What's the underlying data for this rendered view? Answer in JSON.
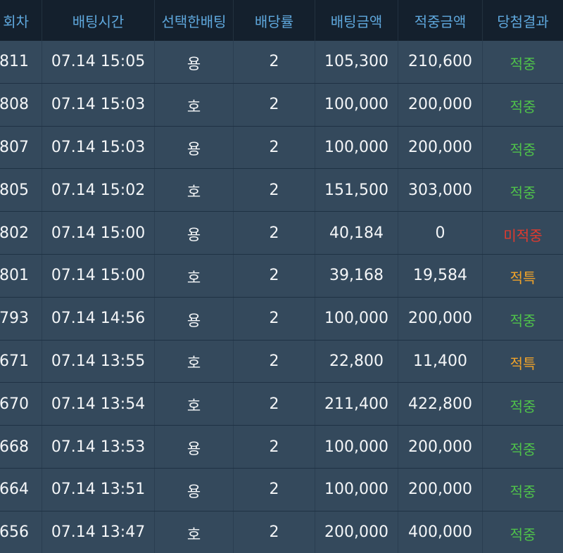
{
  "colors": {
    "header_bg": "#14202d",
    "header_text": "#5fa8dd",
    "row_bg": "#34495c",
    "win": "#4fc24a",
    "lose": "#e03a2e",
    "special": "#f0a32a"
  },
  "headers": {
    "round": "회차",
    "bet_time": "배팅시간",
    "selection": "선택한배팅",
    "odds": "배당률",
    "bet_amount": "배팅금액",
    "win_amount": "적중금액",
    "result": "당첨결과"
  },
  "rows": [
    {
      "round": "811",
      "time": "07.14 15:05",
      "pick": "용",
      "odds": "2",
      "bet": "105,300",
      "win": "210,600",
      "result": "적중",
      "status": "win"
    },
    {
      "round": "808",
      "time": "07.14 15:03",
      "pick": "호",
      "odds": "2",
      "bet": "100,000",
      "win": "200,000",
      "result": "적중",
      "status": "win"
    },
    {
      "round": "807",
      "time": "07.14 15:03",
      "pick": "용",
      "odds": "2",
      "bet": "100,000",
      "win": "200,000",
      "result": "적중",
      "status": "win"
    },
    {
      "round": "805",
      "time": "07.14 15:02",
      "pick": "호",
      "odds": "2",
      "bet": "151,500",
      "win": "303,000",
      "result": "적중",
      "status": "win"
    },
    {
      "round": "802",
      "time": "07.14 15:00",
      "pick": "용",
      "odds": "2",
      "bet": "40,184",
      "win": "0",
      "result": "미적중",
      "status": "lose"
    },
    {
      "round": "801",
      "time": "07.14 15:00",
      "pick": "호",
      "odds": "2",
      "bet": "39,168",
      "win": "19,584",
      "result": "적특",
      "status": "special"
    },
    {
      "round": "793",
      "time": "07.14 14:56",
      "pick": "용",
      "odds": "2",
      "bet": "100,000",
      "win": "200,000",
      "result": "적중",
      "status": "win"
    },
    {
      "round": "671",
      "time": "07.14 13:55",
      "pick": "호",
      "odds": "2",
      "bet": "22,800",
      "win": "11,400",
      "result": "적특",
      "status": "special"
    },
    {
      "round": "670",
      "time": "07.14 13:54",
      "pick": "호",
      "odds": "2",
      "bet": "211,400",
      "win": "422,800",
      "result": "적중",
      "status": "win"
    },
    {
      "round": "668",
      "time": "07.14 13:53",
      "pick": "용",
      "odds": "2",
      "bet": "100,000",
      "win": "200,000",
      "result": "적중",
      "status": "win"
    },
    {
      "round": "664",
      "time": "07.14 13:51",
      "pick": "용",
      "odds": "2",
      "bet": "100,000",
      "win": "200,000",
      "result": "적중",
      "status": "win"
    },
    {
      "round": "656",
      "time": "07.14 13:47",
      "pick": "호",
      "odds": "2",
      "bet": "200,000",
      "win": "400,000",
      "result": "적중",
      "status": "win"
    }
  ]
}
